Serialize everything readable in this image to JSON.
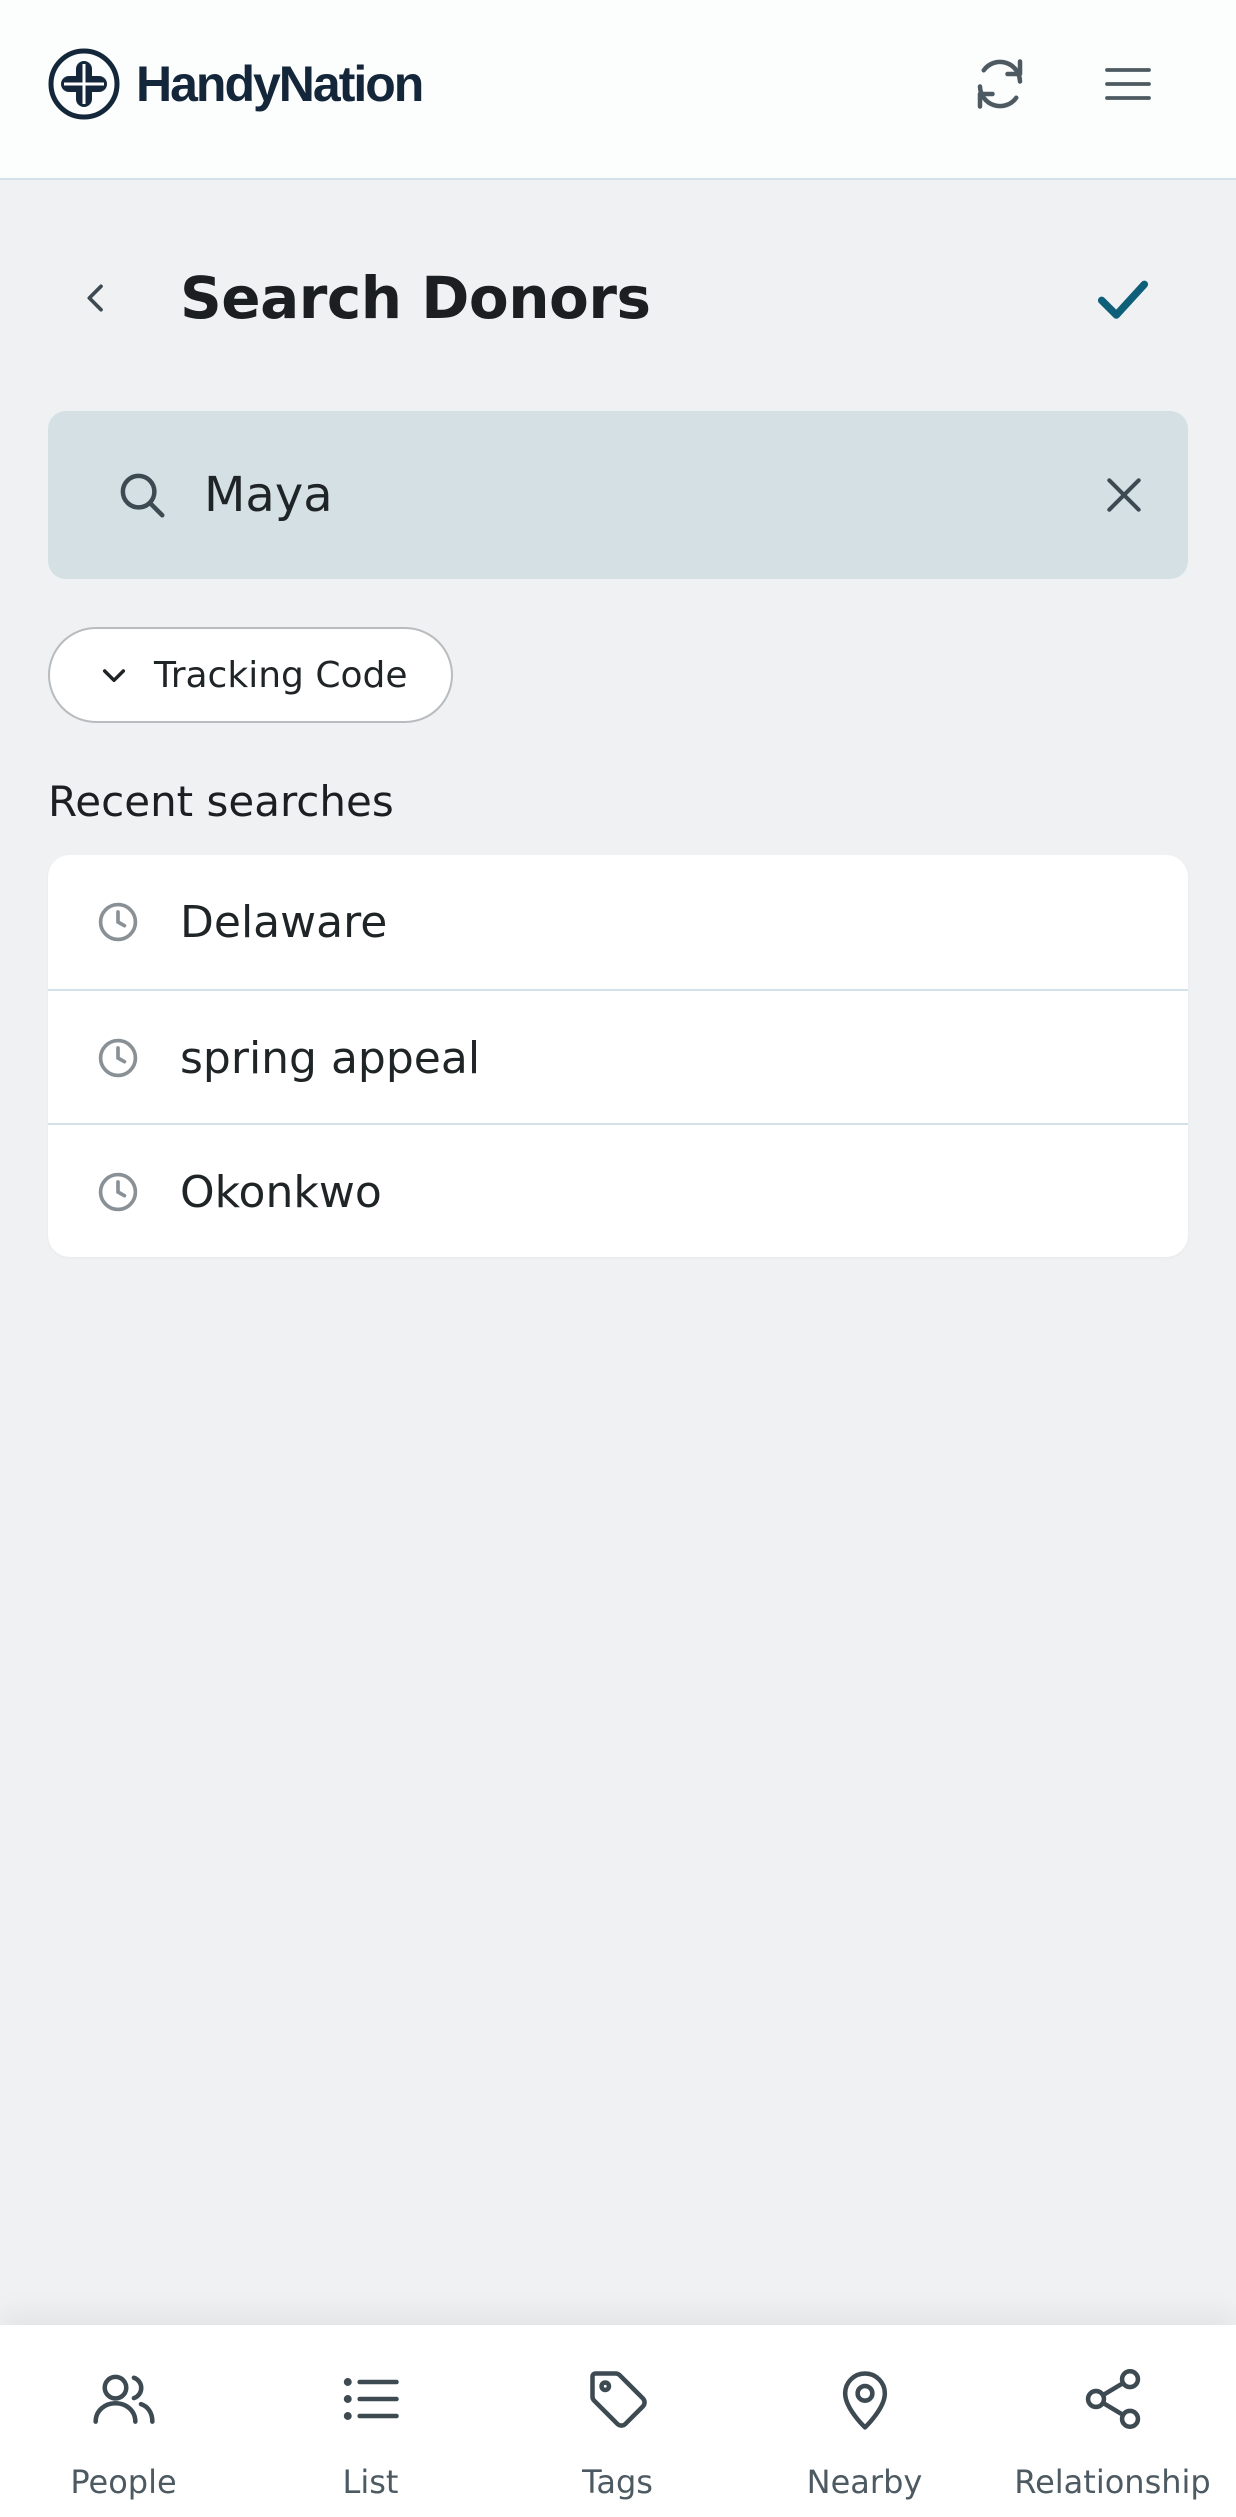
{
  "header": {
    "brand_name": "HandyNation",
    "refresh_icon": "refresh-icon",
    "menu_icon": "hamburger-menu-icon"
  },
  "page": {
    "title": "Search Donors",
    "back_icon": "chevron-left-icon",
    "confirm_icon": "checkmark-icon"
  },
  "search": {
    "value": "Maya",
    "icon": "search-icon",
    "clear_icon": "close-icon"
  },
  "filter_chip": {
    "label": "Tracking Code",
    "icon": "chevron-down-icon"
  },
  "recent": {
    "title": "Recent searches",
    "items": [
      {
        "label": "Delaware",
        "icon": "clock-icon"
      },
      {
        "label": "spring appeal",
        "icon": "clock-icon"
      },
      {
        "label": "Okonkwo",
        "icon": "clock-icon"
      }
    ]
  },
  "bottom_nav": {
    "items": [
      {
        "label": "People",
        "icon": "people-icon"
      },
      {
        "label": "List",
        "icon": "list-icon"
      },
      {
        "label": "Tags",
        "icon": "tag-icon"
      },
      {
        "label": "Nearby",
        "icon": "map-pin-icon"
      },
      {
        "label": "Relationship",
        "icon": "share-network-icon"
      }
    ]
  },
  "colors": {
    "brand": "#14273a",
    "accent": "#0e5f78",
    "background": "#eff1f3",
    "search_background": "#d5e0e4",
    "divider": "#d3e1e8",
    "nav_text": "#4d5a62"
  }
}
